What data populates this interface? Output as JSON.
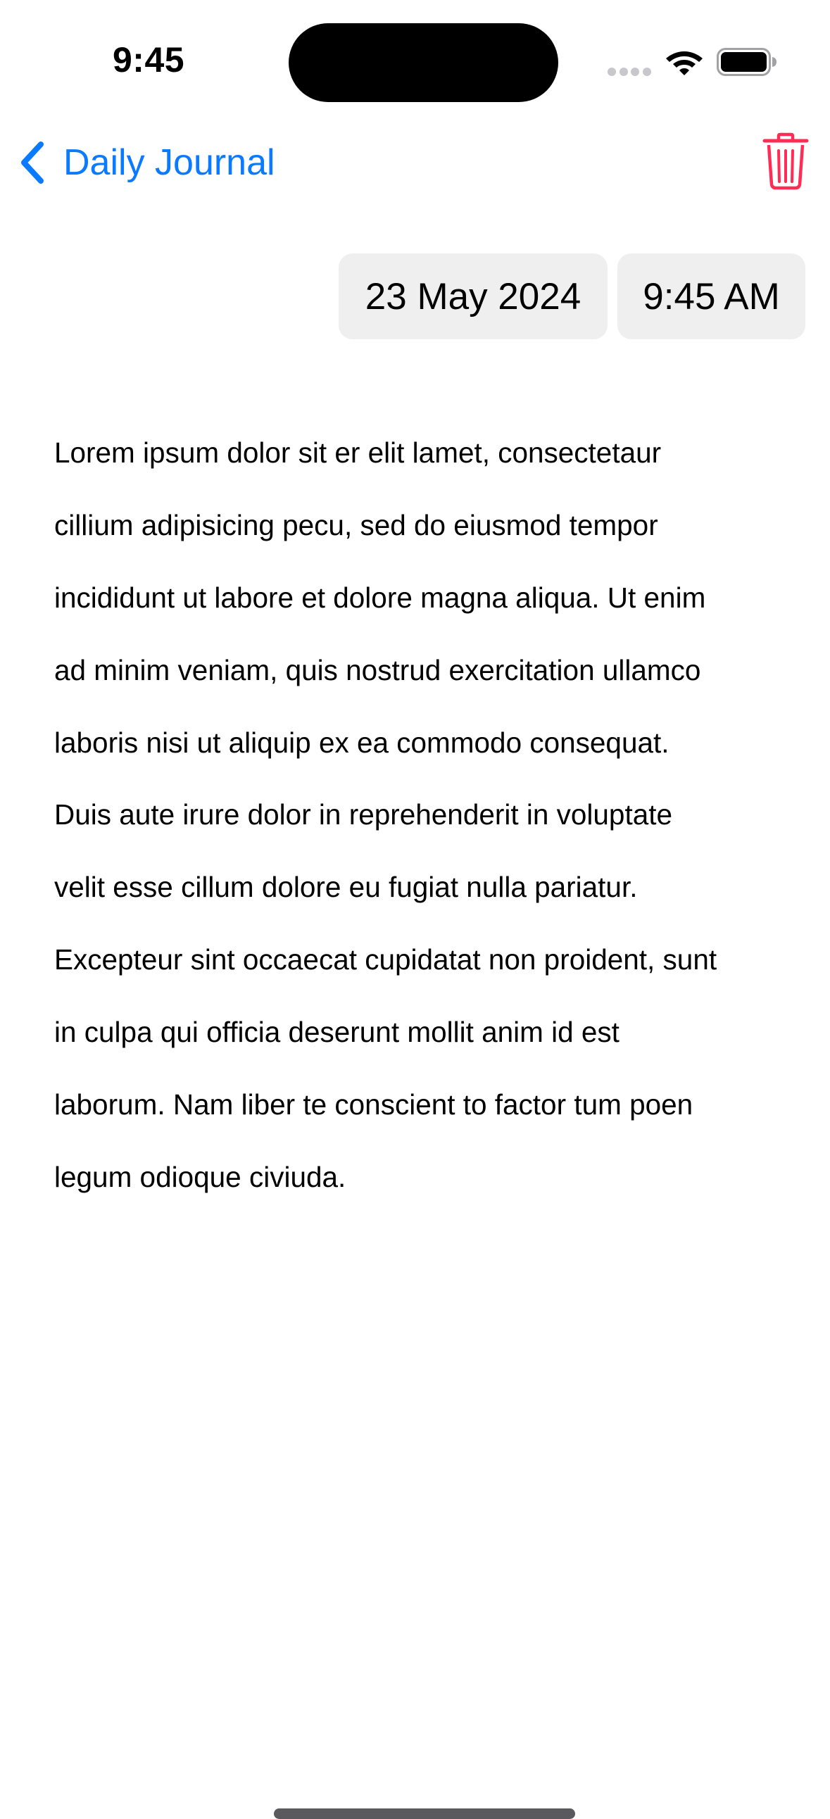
{
  "status_bar": {
    "time": "9:45",
    "icons": [
      "cellular-signal-icon",
      "wifi-icon",
      "battery-icon"
    ]
  },
  "nav": {
    "back_label": "Daily Journal",
    "back_icon": "chevron-left-icon",
    "delete_icon": "trash-icon"
  },
  "entry": {
    "date": "23 May 2024",
    "time": "9:45 AM",
    "lines": [
      "Lorem ipsum dolor sit er elit lamet, consectetaur",
      "cillium adipisicing pecu, sed do eiusmod tempor",
      "incididunt ut labore et dolore magna aliqua. Ut enim",
      "ad minim veniam, quis nostrud exercitation ullamco",
      "laboris nisi ut aliquip ex ea commodo consequat.",
      "Duis aute irure dolor in reprehenderit in voluptate",
      "velit esse cillum dolore eu fugiat nulla pariatur.",
      "Excepteur sint occaecat cupidatat non proident, sunt",
      "in culpa qui officia deserunt mollit anim id est",
      "laborum. Nam liber te conscient to factor tum poen",
      "legum odioque civiuda."
    ]
  },
  "colors": {
    "accent": "#0a7aff",
    "destructive": "#ff2d55",
    "pill_background": "#efeff0"
  }
}
